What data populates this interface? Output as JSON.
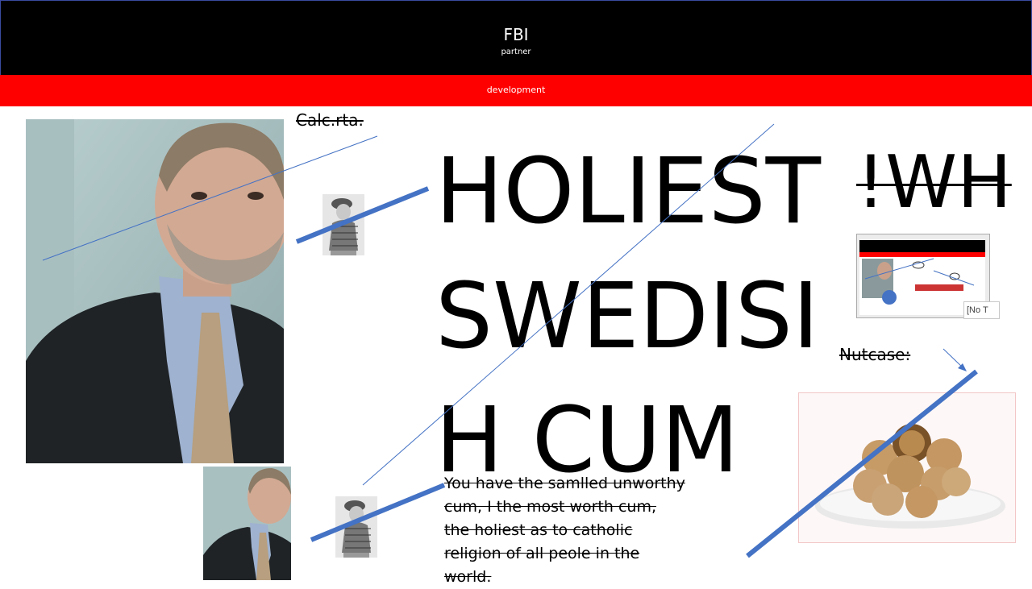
{
  "header": {
    "title": "FBI",
    "subtitle": "partner"
  },
  "banner": {
    "label": "development"
  },
  "labels": {
    "calc": "Calc.rta.",
    "nutcase": "Nutcase:"
  },
  "headline": {
    "line1": "HOLIEST",
    "line2": "SWEDISI",
    "line3": "H CUM",
    "side": "!WH"
  },
  "paragraph": "You have the samlled unworthy cum, I the most worth cum, the holiest as to catholic religion of all peole in the world.",
  "thumbnail": {
    "tooltip": "[No T"
  },
  "colors": {
    "topbar": "#000000",
    "banner": "#ff0000",
    "connector": "#4472c4",
    "text": "#000000"
  }
}
